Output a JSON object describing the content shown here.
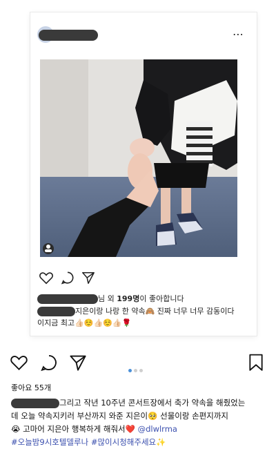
{
  "inner_post": {
    "liked_by_suffix": "님 외",
    "likes_count": "199명",
    "likes_tail": "이 좋아합니다",
    "caption_line1": "지은이랑 나랑 한 약속🙈 진짜 너무 너무 감동이다",
    "caption_line2": "이지금 최고👍🏻☺️👍🏻☺️👍🏻🌹",
    "more_label": "⋯"
  },
  "outer_post": {
    "likes": "좋아요 55개",
    "caption_l1": "그리고 작년 10주년 콘서트장에서 축가 약속을 해줬었는",
    "caption_l2": "데 오늘 약속지키러 부산까지 와준 지은이🥺 선물이랑 손편지까지",
    "caption_l3a": "😭 고마어 지은아 행복하게 해줘서❤️ ",
    "mention": "@dlwlrma",
    "hashtags": "#오늘밤9시호텔델루나 #많이시청해주세요✨"
  },
  "icons": [
    "heart-icon",
    "comment-icon",
    "share-icon",
    "bookmark-icon",
    "more-icon"
  ],
  "colors": {
    "accent": "#4a90d9",
    "link": "#3b4fae",
    "redaction": "#3a3a3a"
  }
}
